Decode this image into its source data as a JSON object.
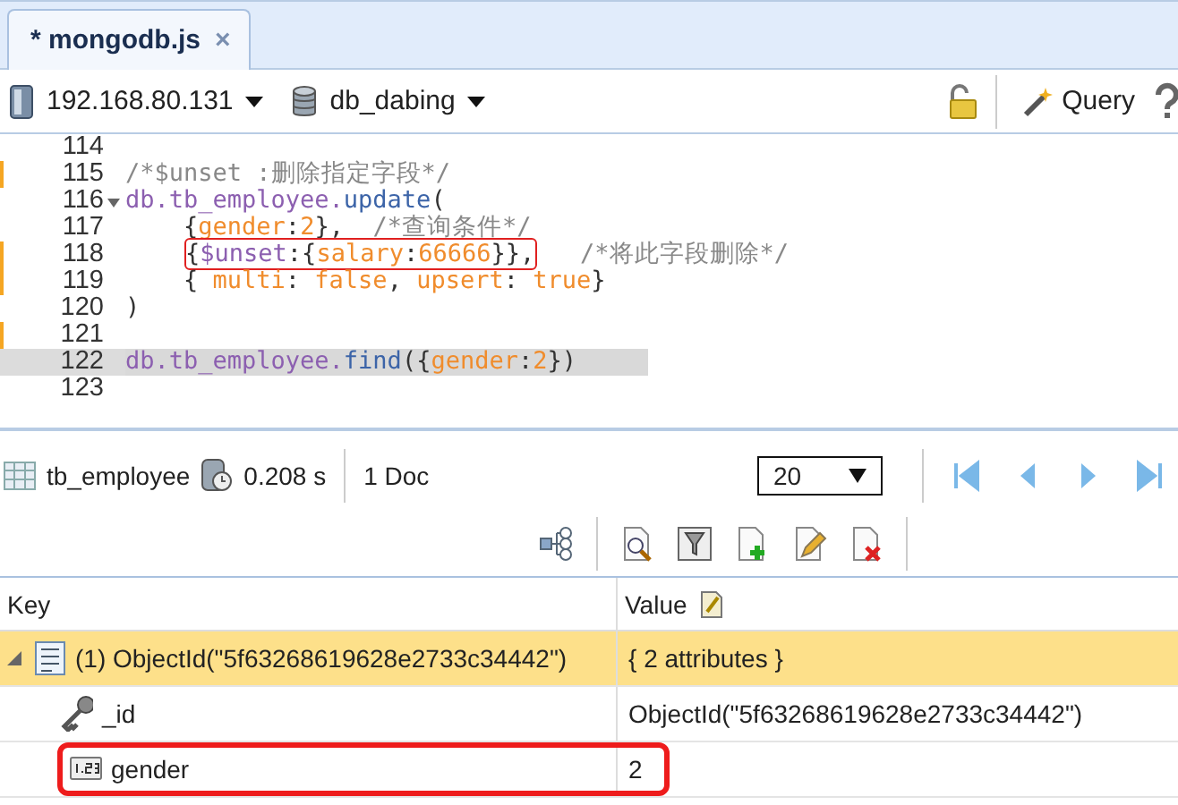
{
  "tabs": [
    {
      "label": "* mongodb.js",
      "close": "×",
      "selected": true
    }
  ],
  "toolbar": {
    "server": "192.168.80.131",
    "database": "db_dabing",
    "query_button": "Query"
  },
  "editor": {
    "lines": [
      {
        "number": "114",
        "changed": false,
        "current": false,
        "foldable": false
      },
      {
        "number": "115",
        "changed": true,
        "current": false,
        "foldable": false,
        "indented": false,
        "tokens": [
          {
            "kind": "comment",
            "text": "/*$unset :删除指定字段*/"
          }
        ]
      },
      {
        "number": "116",
        "changed": false,
        "current": false,
        "foldable": true,
        "indented": false,
        "tokens": [
          {
            "kind": "object",
            "text": "db.tb_employee."
          },
          {
            "kind": "method",
            "text": "update"
          },
          {
            "kind": "punct",
            "text": "("
          }
        ]
      },
      {
        "number": "117",
        "changed": false,
        "current": false,
        "foldable": false,
        "indented": true,
        "tokens": [
          {
            "kind": "punct",
            "text": "{"
          },
          {
            "kind": "value",
            "text": "gender"
          },
          {
            "kind": "punct",
            "text": ":"
          },
          {
            "kind": "value",
            "text": "2"
          },
          {
            "kind": "punct",
            "text": "},  "
          },
          {
            "kind": "comment",
            "text": "/*查询条件*/"
          }
        ]
      },
      {
        "number": "118",
        "changed": true,
        "current": false,
        "foldable": false,
        "indented": true,
        "tokens": [
          {
            "kind": "boxed",
            "tokens": [
              {
                "kind": "punct",
                "text": "{"
              },
              {
                "kind": "object",
                "text": "$unset"
              },
              {
                "kind": "punct",
                "text": ":{"
              },
              {
                "kind": "value",
                "text": "salary"
              },
              {
                "kind": "punct",
                "text": ":"
              },
              {
                "kind": "value",
                "text": "66666"
              },
              {
                "kind": "punct",
                "text": "}},"
              }
            ]
          },
          {
            "kind": "comment",
            "text": "/*将此字段删除*/"
          }
        ]
      },
      {
        "number": "119",
        "changed": true,
        "current": false,
        "foldable": false,
        "indented": true,
        "tokens": [
          {
            "kind": "punct",
            "text": "{ "
          },
          {
            "kind": "value",
            "text": "multi"
          },
          {
            "kind": "punct",
            "text": ": "
          },
          {
            "kind": "value",
            "text": "false"
          },
          {
            "kind": "punct",
            "text": ", "
          },
          {
            "kind": "value",
            "text": "upsert"
          },
          {
            "kind": "punct",
            "text": ": "
          },
          {
            "kind": "value",
            "text": "true"
          },
          {
            "kind": "punct",
            "text": "}"
          }
        ]
      },
      {
        "number": "120",
        "changed": false,
        "current": false,
        "foldable": false,
        "indented": false,
        "tokens": [
          {
            "kind": "punct",
            "text": ")"
          }
        ]
      },
      {
        "number": "121",
        "changed": true,
        "current": false,
        "foldable": false
      },
      {
        "number": "122",
        "changed": false,
        "current": true,
        "foldable": false,
        "indented": false,
        "tokens": [
          {
            "kind": "object",
            "text": "db.tb_employee."
          },
          {
            "kind": "method",
            "text": "find"
          },
          {
            "kind": "punct",
            "text": "({"
          },
          {
            "kind": "value",
            "text": "gender"
          },
          {
            "kind": "punct",
            "text": ":"
          },
          {
            "kind": "value",
            "text": "2"
          },
          {
            "kind": "punct",
            "text": "})"
          }
        ]
      },
      {
        "number": "123",
        "changed": false,
        "current": false,
        "foldable": false
      }
    ]
  },
  "result_bar": {
    "collection": "tb_employee",
    "time": "0.208 s",
    "count": "1 Doc",
    "page_size": "20"
  },
  "table": {
    "columns": [
      "Key",
      "Value"
    ],
    "rows": [
      {
        "kind": "document",
        "key": "(1) ObjectId(\"5f63268619628e2733c34442\")",
        "value": "{ 2 attributes }",
        "expanded": true,
        "selected": true,
        "boxed": false,
        "children": [
          {
            "kind": "id",
            "key": "_id",
            "value": "ObjectId(\"5f63268619628e2733c34442\")",
            "selected": false,
            "boxed": false
          },
          {
            "kind": "number",
            "key": "gender",
            "value": "2",
            "selected": false,
            "boxed": true
          }
        ]
      }
    ]
  }
}
